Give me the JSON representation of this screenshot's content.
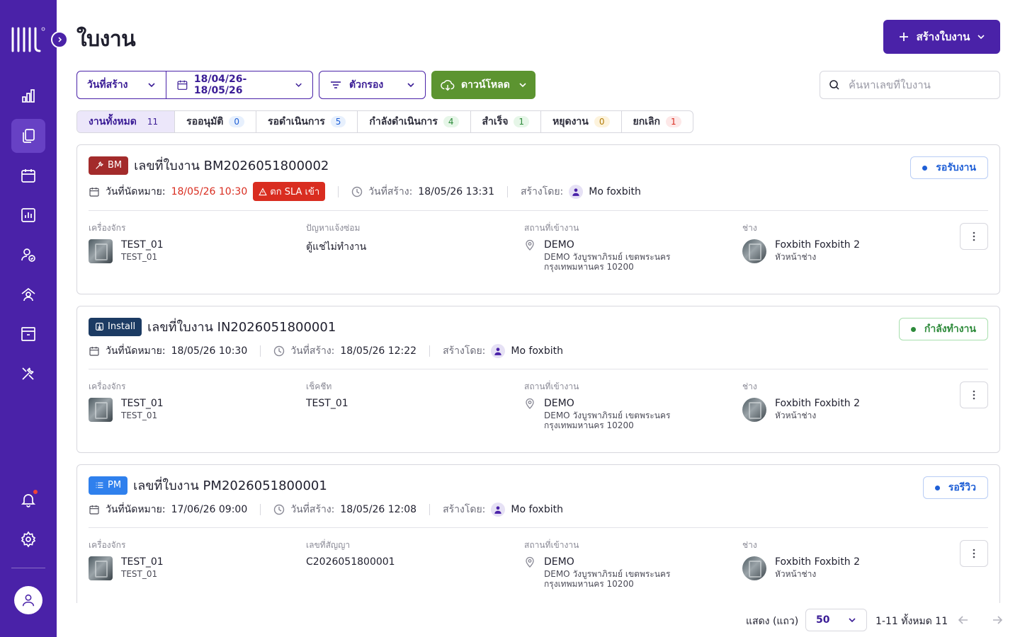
{
  "app": {
    "brand_color": "#4a22a8",
    "logo_name": "brand-logo"
  },
  "sidebar": {
    "items": [
      {
        "name": "dashboard",
        "icon": "bar-chart-icon"
      },
      {
        "name": "work-orders",
        "icon": "documents-icon",
        "active": true
      },
      {
        "name": "calendar",
        "icon": "calendar-icon"
      },
      {
        "name": "reports",
        "icon": "report-chart-icon"
      },
      {
        "name": "users",
        "icon": "user-check-icon"
      },
      {
        "name": "technicians",
        "icon": "house-user-icon"
      },
      {
        "name": "archive",
        "icon": "archive-box-icon"
      },
      {
        "name": "tools",
        "icon": "tools-icon"
      }
    ],
    "bottom": [
      {
        "name": "notifications",
        "icon": "bell-icon"
      },
      {
        "name": "settings",
        "icon": "gear-icon"
      }
    ]
  },
  "header": {
    "title": "ใบงาน",
    "create_label": "สร้างใบงาน"
  },
  "filters": {
    "date_type": "วันที่สร้าง",
    "date_range": "18/04/26-18/05/26",
    "filter_label": "ตัวกรอง",
    "download_label": "ดาวน์โหลด",
    "search_placeholder": "ค้นหาเลขที่ใบงาน"
  },
  "tabs": [
    {
      "label": "งานทั้งหมด",
      "count": "11"
    },
    {
      "label": "รออนุมัติ",
      "count": "0"
    },
    {
      "label": "รอดำเนินการ",
      "count": "5"
    },
    {
      "label": "กำลังดำเนินการ",
      "count": "4"
    },
    {
      "label": "สำเร็จ",
      "count": "1"
    },
    {
      "label": "หยุดงาน",
      "count": "0"
    },
    {
      "label": "ยกเลิก",
      "count": "1"
    }
  ],
  "labels": {
    "due": "วันที่นัดหมาย:",
    "created": "วันที่สร้าง:",
    "created_by": "สร้างโดย:",
    "machine": "เครื่องจักร",
    "location": "สถานที่เข้างาน",
    "technician": "ช่าง"
  },
  "cards": [
    {
      "type_label": "BM",
      "number": "เลขที่ใบงาน BM2026051800002",
      "due": "18/05/26 10:30",
      "sla": "ตก SLA เข้า",
      "created": "18/05/26 13:31",
      "creator": "Mo foxbith",
      "status": "รอรับงาน",
      "machine_name": "TEST_01",
      "machine_code": "TEST_01",
      "second_col_label": "ปัญหาแจ้งซ่อม",
      "second_col_value": "ตู้แช่ไม่ทำงาน",
      "location_name": "DEMO",
      "location_address": "DEMO วังบูรพาภิรมย์ เขตพระนคร กรุงเทพมหานคร 10200",
      "tech_name": "Foxbith Foxbith 2",
      "tech_role": "หัวหน้าช่าง"
    },
    {
      "type_label": "Install",
      "number": "เลขที่ใบงาน IN2026051800001",
      "due": "18/05/26 10:30",
      "created": "18/05/26 12:22",
      "creator": "Mo foxbith",
      "status": "กำลังทำงาน",
      "machine_name": "TEST_01",
      "machine_code": "TEST_01",
      "second_col_label": "เช็คชีท",
      "second_col_value": "TEST_01",
      "location_name": "DEMO",
      "location_address": "DEMO วังบูรพาภิรมย์ เขตพระนคร กรุงเทพมหานคร 10200",
      "tech_name": "Foxbith Foxbith 2",
      "tech_role": "หัวหน้าช่าง"
    },
    {
      "type_label": "PM",
      "number": "เลขที่ใบงาน PM2026051800001",
      "due": "17/06/26 09:00",
      "created": "18/05/26 12:08",
      "creator": "Mo foxbith",
      "status": "รอรีวิว",
      "machine_name": "TEST_01",
      "machine_code": "TEST_01",
      "second_col_label": "เลขที่สัญญา",
      "second_col_value": "C2026051800001",
      "location_name": "DEMO",
      "location_address": "DEMO วังบูรพาภิรมย์ เขตพระนคร กรุงเทพมหานคร 10200",
      "tech_name": "Foxbith Foxbith 2",
      "tech_role": "หัวหน้าช่าง"
    }
  ],
  "footer": {
    "rows_label": "แสดง (แถว)",
    "rows_value": "50",
    "range_text": "1-11 ทั้งหมด 11"
  },
  "colors": {
    "primary": "#4a22a8",
    "download": "#5c9430",
    "danger": "#d92d20",
    "status_blue": "#1f5fd6",
    "status_green": "#2d8a3a"
  }
}
